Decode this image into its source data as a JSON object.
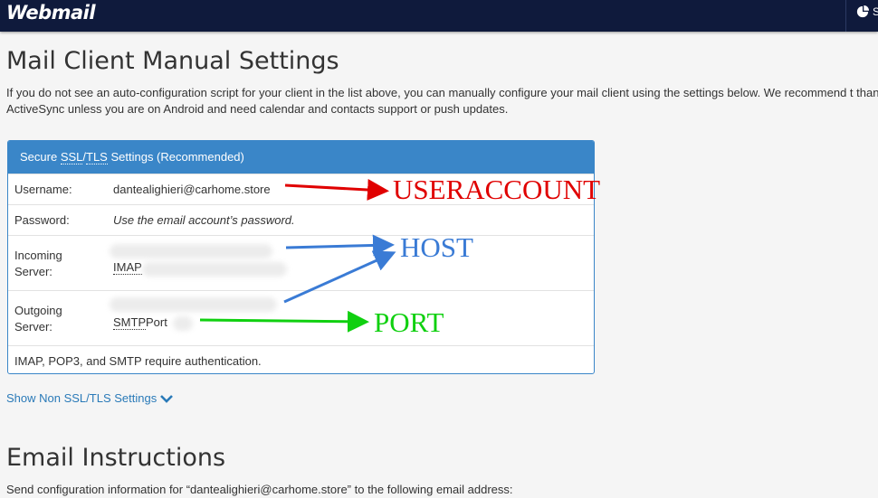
{
  "header": {
    "logo_text": "Webmail",
    "stats_label": "S"
  },
  "page": {
    "title": "Mail Client Manual Settings",
    "intro": "If you do not see an auto-configuration script for your client in the list above, you can manually configure your mail client using the settings below. We recommend t than ActiveSync unless you are on Android and need calendar and contacts support or push updates."
  },
  "panel": {
    "title_prefix": "Secure ",
    "title_ssl": "SSL",
    "title_sep": "/",
    "title_tls": "TLS",
    "title_suffix": " Settings (Recommended)",
    "username_label": "Username:",
    "username_value": "dantealighieri@carhome.store",
    "password_label": "Password:",
    "password_value": "Use the email account’s password.",
    "incoming_label_1": "Incoming",
    "incoming_label_2": "Server:",
    "incoming_protocol": "IMAP",
    "outgoing_label_1": "Outgoing",
    "outgoing_label_2": "Server:",
    "outgoing_protocol": "SMTP",
    "outgoing_port_label": "Port",
    "note": "IMAP, POP3, and SMTP require authentication."
  },
  "show_non_ssl": "Show Non SSL/TLS Settings",
  "email_instructions": {
    "title": "Email Instructions",
    "send_text": "Send configuration information for “dantealighieri@carhome.store” to the following email address:"
  },
  "annotations": {
    "useraccount": "USERACCOUNT",
    "host": "HOST",
    "port": "PORT",
    "colors": {
      "useraccount": "#e00000",
      "host": "#3a7bd5",
      "port": "#10d010"
    }
  }
}
